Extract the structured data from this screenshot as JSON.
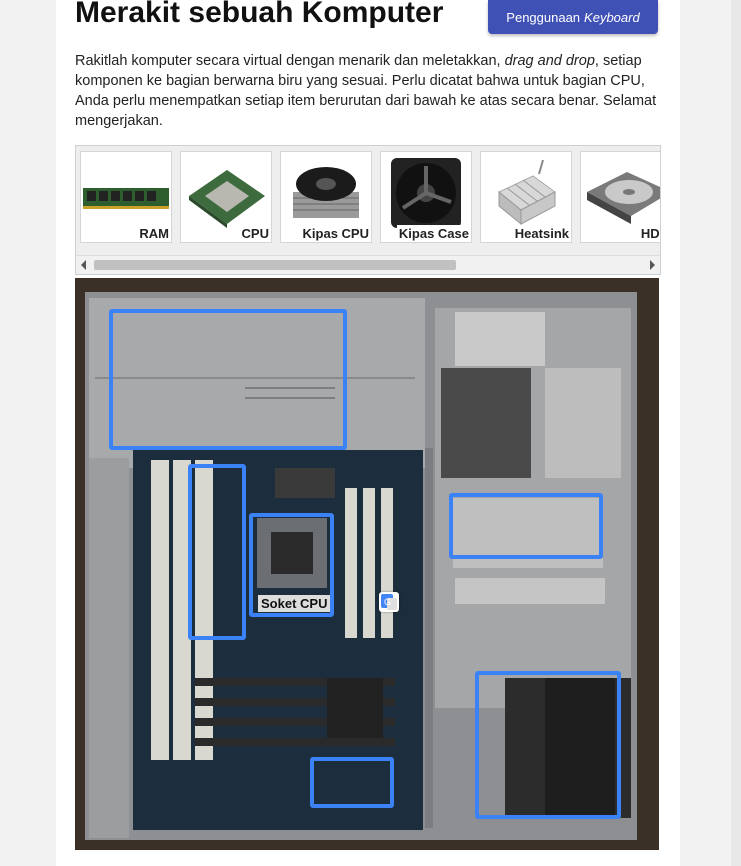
{
  "header": {
    "title": "Merakit sebuah Komputer",
    "keyboard_button": {
      "label": "Penggunaan",
      "label_em": "Keyboard"
    }
  },
  "intro": {
    "part1": "Rakitlah komputer secara virtual dengan menarik dan meletakkan, ",
    "em": "drag and drop",
    "part2": ", setiap komponen ke bagian berwarna biru yang sesuai. Perlu dicatat bahwa untuk bagian CPU, Anda perlu menempatkan setiap item berurutan dari bawah ke atas secara benar. Selamat mengerjakan."
  },
  "tray": {
    "items": [
      {
        "label": "RAM",
        "icon": "ram-stick-icon"
      },
      {
        "label": "CPU",
        "icon": "cpu-chip-icon"
      },
      {
        "label": "Kipas CPU",
        "icon": "cpu-fan-icon"
      },
      {
        "label": "Kipas Case",
        "icon": "case-fan-icon"
      },
      {
        "label": "Heatsink",
        "icon": "heatsink-icon"
      },
      {
        "label": "HDD",
        "icon": "hard-drive-icon"
      }
    ]
  },
  "board": {
    "socket_label": "Soket CPU",
    "target_color": "#3b82f6"
  },
  "colors": {
    "accent": "#3f51b5",
    "target": "#3b82f6"
  }
}
